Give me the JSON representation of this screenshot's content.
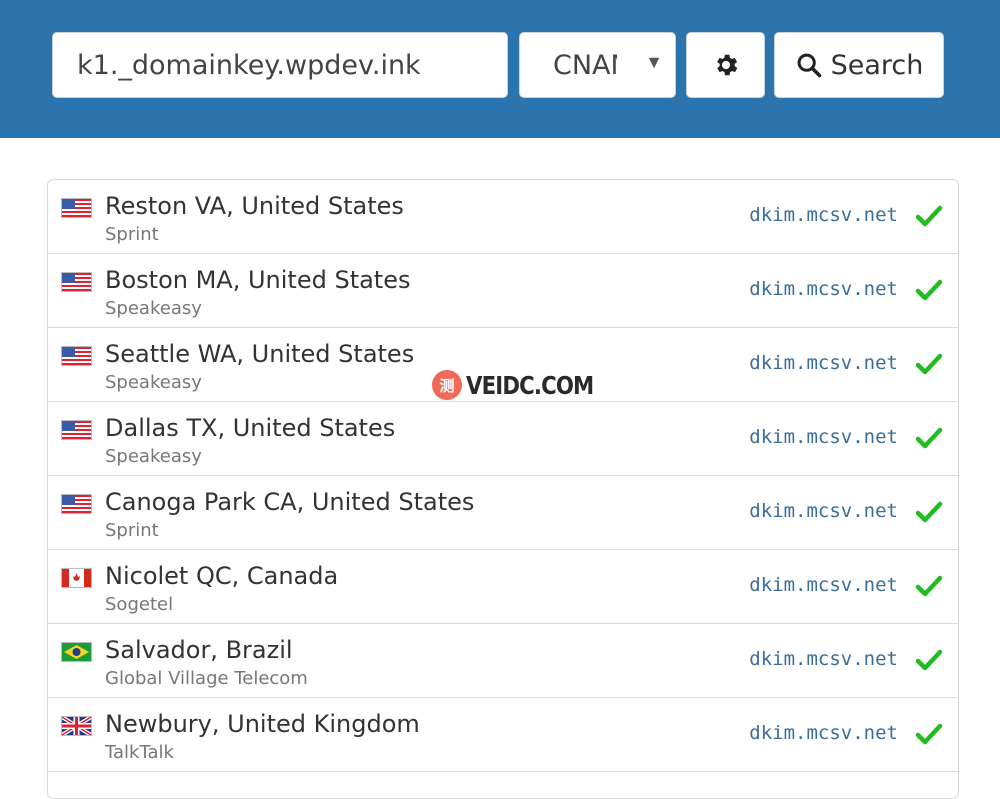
{
  "search": {
    "query": "k1._domainkey.wpdev.ink",
    "record_type": "CNAME",
    "search_label": "Search"
  },
  "icons": {
    "settings": "gear-icon",
    "search": "search-icon",
    "status_ok": "check-icon"
  },
  "colors": {
    "header_bg": "#2b74ad",
    "answer_text": "#3a6d9a",
    "check_green": "#22bb22"
  },
  "results": [
    {
      "location": "Reston VA, United States",
      "isp": "Sprint",
      "answer": "dkim.mcsv.net",
      "flag": "us",
      "status": "ok"
    },
    {
      "location": "Boston MA, United States",
      "isp": "Speakeasy",
      "answer": "dkim.mcsv.net",
      "flag": "us",
      "status": "ok"
    },
    {
      "location": "Seattle WA, United States",
      "isp": "Speakeasy",
      "answer": "dkim.mcsv.net",
      "flag": "us",
      "status": "ok"
    },
    {
      "location": "Dallas TX, United States",
      "isp": "Speakeasy",
      "answer": "dkim.mcsv.net",
      "flag": "us",
      "status": "ok"
    },
    {
      "location": "Canoga Park CA, United States",
      "isp": "Sprint",
      "answer": "dkim.mcsv.net",
      "flag": "us",
      "status": "ok"
    },
    {
      "location": "Nicolet QC, Canada",
      "isp": "Sogetel",
      "answer": "dkim.mcsv.net",
      "flag": "ca",
      "status": "ok"
    },
    {
      "location": "Salvador, Brazil",
      "isp": "Global Village Telecom",
      "answer": "dkim.mcsv.net",
      "flag": "br",
      "status": "ok"
    },
    {
      "location": "Newbury, United Kingdom",
      "isp": "TalkTalk",
      "answer": "dkim.mcsv.net",
      "flag": "gb",
      "status": "ok"
    }
  ],
  "watermark": {
    "seal": "测",
    "text": "VEIDC.COM"
  }
}
